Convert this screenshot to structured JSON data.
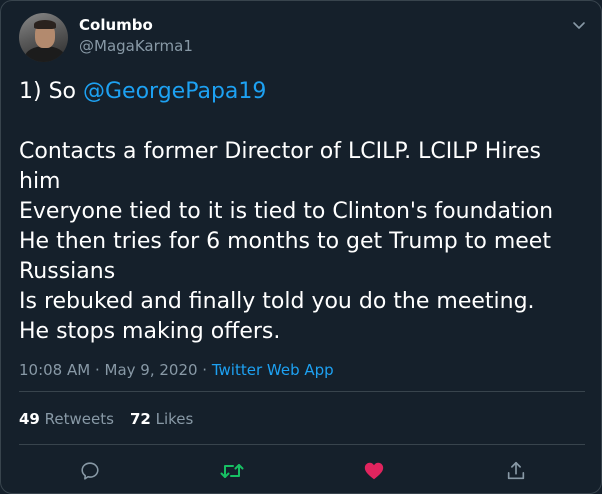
{
  "author": {
    "display_name": "Columbo",
    "handle": "@MagaKarma1"
  },
  "tweet": {
    "prefix": "1) So ",
    "mention": "@GeorgePapa19",
    "lines": [
      "Contacts a former Director of LCILP. LCILP Hires",
      "him",
      "Everyone tied to it is tied to Clinton's foundation",
      "He then tries for 6 months to get Trump to meet",
      "Russians",
      "Is rebuked and finally told you do the meeting.",
      "He stops making offers."
    ],
    "timestamp": "10:08 AM · May 9, 2020 · ",
    "source_app": "Twitter Web App"
  },
  "stats": {
    "retweets_count": "49",
    "retweets_label": " Retweets",
    "likes_count": "72",
    "likes_label": " Likes"
  },
  "actions": [
    {
      "icon": "reply-icon"
    },
    {
      "icon": "retweet-icon",
      "color": "#17bf63"
    },
    {
      "icon": "like-icon",
      "color": "#e0245e"
    },
    {
      "icon": "share-icon"
    }
  ],
  "colors": {
    "background": "#15202b",
    "accent": "#1da1f2",
    "muted": "#8899a6",
    "border": "#38444d"
  }
}
